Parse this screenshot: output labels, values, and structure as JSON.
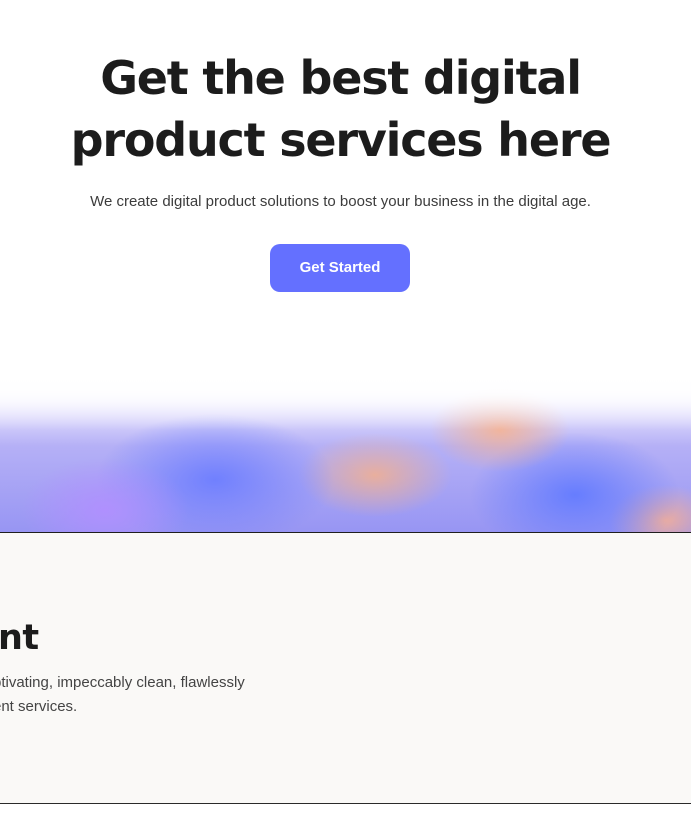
{
  "hero": {
    "title_line_1": "Get the best digital",
    "title_line_2": "product services here",
    "subtitle": "We create digital product solutions to boost your business in the digital age.",
    "cta_label": "Get Started"
  },
  "service": {
    "title_fragment": "nt",
    "description_line_1": "ptivating, impeccably clean, flawlessly",
    "description_line_2": "ent services."
  },
  "colors": {
    "primary": "#6470ff",
    "text_dark": "#1c1c1c",
    "text_muted": "#444444",
    "section_bg": "#faf9f7"
  }
}
